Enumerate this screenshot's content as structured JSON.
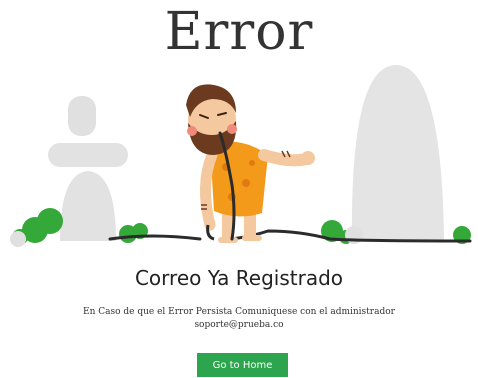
{
  "page": {
    "title": "Error",
    "heading": "Correo Ya Registrado",
    "message_line1": "En Caso de que el Error Persista Comuniquese con el administrador",
    "message_line2": "soporte@prueba.co",
    "button_label": "Go to Home"
  },
  "illustration": {
    "icon": "caveman-tangled-cable-illustration"
  },
  "colors": {
    "button": "#2da54e",
    "bush": "#35a83a",
    "rock": "#e2e2e2",
    "skin": "#f5c9a0",
    "hair": "#6b3a1f",
    "outfit": "#f39a1b",
    "cable": "#2b2b2b"
  }
}
